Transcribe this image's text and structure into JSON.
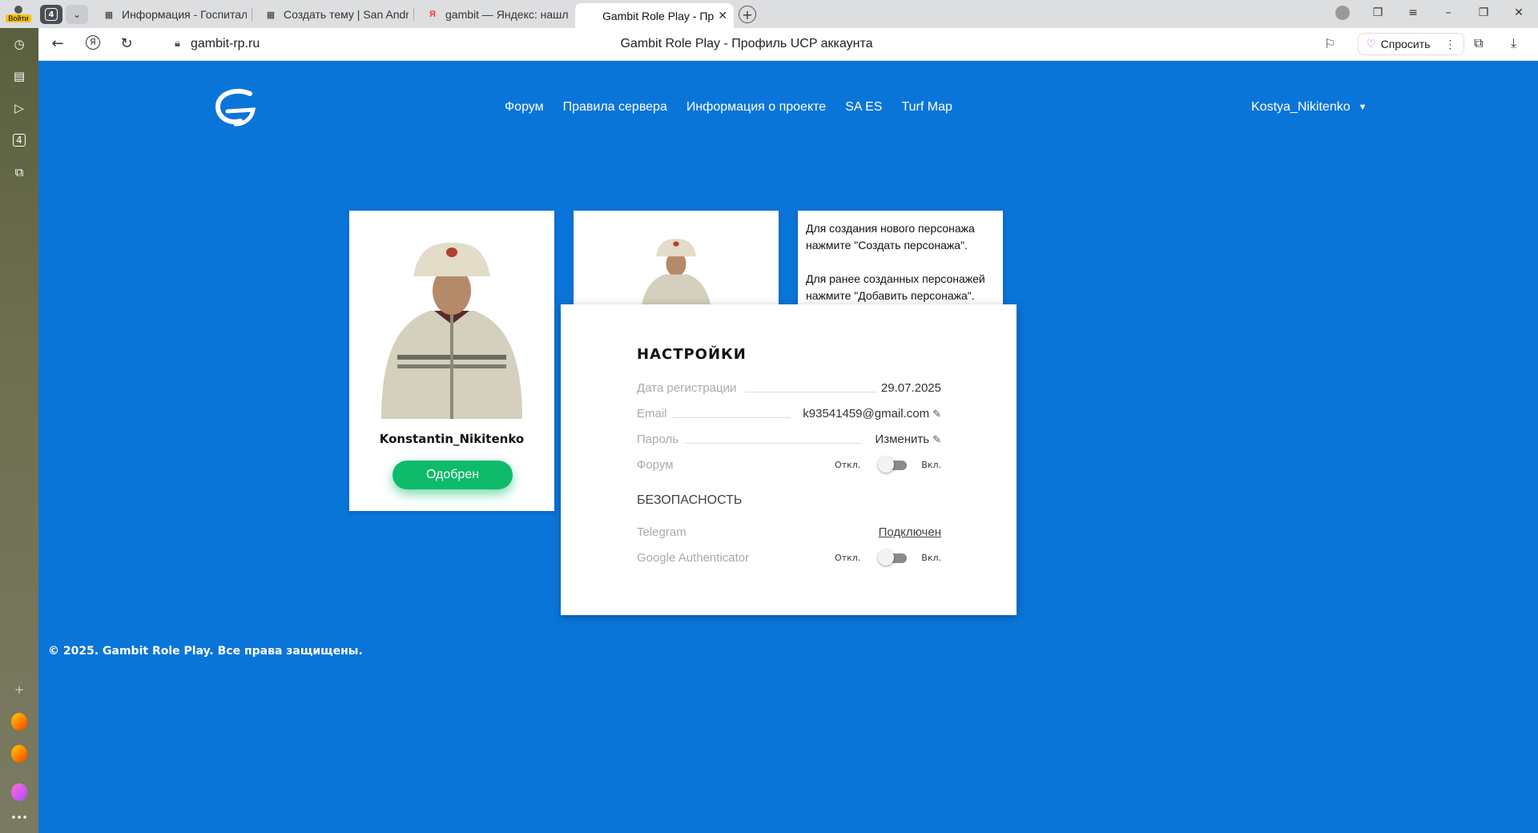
{
  "browser": {
    "profile_label": "Войти",
    "tab_count": "4",
    "tabs": [
      {
        "title": "Информация - Госпиталь",
        "icon": "forum-icon"
      },
      {
        "title": "Создать тему | San Andreas",
        "icon": "forum-icon"
      },
      {
        "title": "gambit — Яндекс: нашлось",
        "icon": "yandex-icon"
      },
      {
        "title": "Gambit Role Play - Профиль",
        "icon": "gambit-icon"
      }
    ],
    "url": "gambit-rp.ru",
    "page_title": "Gambit Role Play - Профиль UCP аккаунта",
    "ask_label": "Спросить"
  },
  "site": {
    "menu": [
      "Форум",
      "Правила сервера",
      "Информация о проекте",
      "SA ES",
      "Turf Map"
    ],
    "username": "Kostya_Nikitenko",
    "character": {
      "name": "Konstantin_Nikitenko",
      "status": "Одобрен"
    },
    "info_text": "Для создания нового персонажа нажмите \"Создать персонажа\".\n\nДля ранее созданных персонажей нажмите \"Добавить персонажа\".",
    "settings": {
      "title": "НАСТРОЙКИ",
      "reg_label": "Дата регистрации",
      "reg_value": "29.07.2025",
      "email_label": "Email",
      "email_value": "k93541459@gmail.com",
      "password_label": "Пароль",
      "password_value": "Изменить",
      "forum_label": "Форум",
      "off_label": "Откл.",
      "on_label": "Вкл.",
      "security_title": "БЕЗОПАСНОСТЬ",
      "telegram_label": "Telegram",
      "telegram_value": "Подключен",
      "ga_label": "Google Authenticator"
    },
    "footer": "© 2025. Gambit Role Play. Все права защищены."
  },
  "colors": {
    "page_bg": "#0a75d8",
    "approved": "#0dbb6a"
  }
}
